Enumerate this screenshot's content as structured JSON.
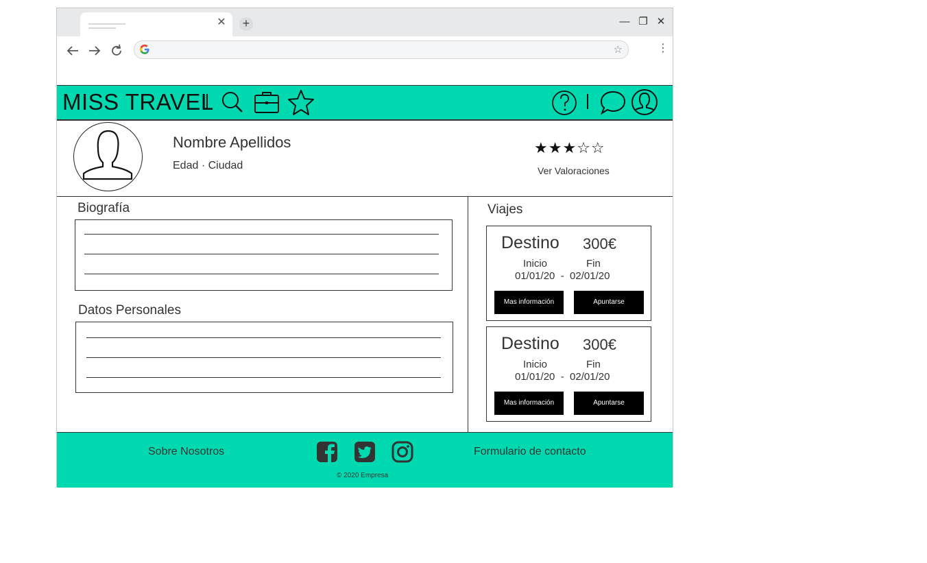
{
  "brand": {
    "name": "MISS TRAVEL",
    "accent_color": "#00d9b0"
  },
  "browser": {
    "tab_close": "✕",
    "new_tab": "+",
    "window_controls": {
      "minimize": "—",
      "maximize": "❐",
      "close": "✕"
    },
    "menu": "⋮",
    "icons": [
      "back-arrow-icon",
      "forward-arrow-icon",
      "reload-icon",
      "google-icon",
      "star-bookmark-icon"
    ]
  },
  "header": {
    "icons": [
      "search-icon",
      "briefcase-icon",
      "star-icon",
      "help-icon",
      "chat-icon",
      "user-icon"
    ]
  },
  "profile": {
    "name": "Nombre Apellidos",
    "meta": "Edad · Ciudad",
    "rating": 3,
    "rating_max": 5,
    "stars_text": "★★★☆☆",
    "ratings_link": "Ver Valoraciones"
  },
  "sections": {
    "bio_title": "Biografía",
    "personal_title": "Datos Personales"
  },
  "trips": {
    "title": "Viajes",
    "items": [
      {
        "destination": "Destino",
        "price": "300€",
        "start_label": "Inicio",
        "end_label": "Fin",
        "dates": "01/01/20  -  02/01/20",
        "info_button": "Mas información",
        "join_button": "Apuntarse"
      },
      {
        "destination": "Destino",
        "price": "300€",
        "start_label": "Inicio",
        "end_label": "Fin",
        "dates": "01/01/20  -  02/01/20",
        "info_button": "Mas información",
        "join_button": "Apuntarse"
      }
    ]
  },
  "footer": {
    "about": "Sobre Nosotros",
    "contact": "Formulario de contacto",
    "copyright": "© 2020 Empresa",
    "social": [
      "facebook-icon",
      "twitter-icon",
      "instagram-icon"
    ]
  }
}
